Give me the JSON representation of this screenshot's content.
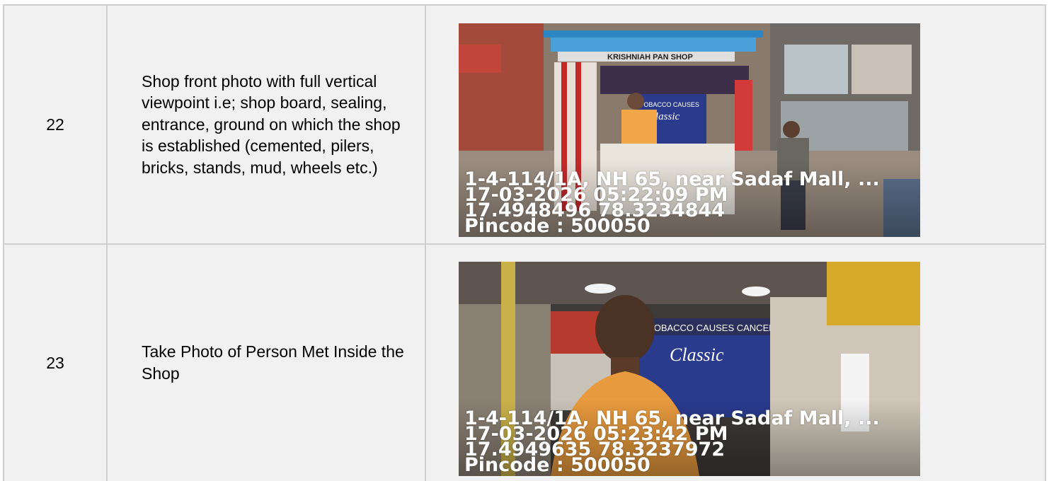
{
  "rows": [
    {
      "number": "22",
      "description": "Shop front photo with full vertical viewpoint i.e; shop board, sealing, entrance, ground on which the shop is established (cemented, pilers, bricks, stands, mud, wheels etc.)",
      "photo": {
        "sign_text": "KRISHNIAH PAN SHOP",
        "poster_text": "TOBACCO CAUSES",
        "brand_text": "Classic",
        "address": "1-4-114/1A, NH 65, near Sadaf Mall, ...",
        "datetime": "17-03-2026 05:22:09 PM",
        "coordinates": "17.4948496 78.3234844",
        "pincode": "Pincode : 500050"
      }
    },
    {
      "number": "23",
      "description": "Take Photo of Person Met Inside the Shop",
      "photo": {
        "poster_text": "TOBACCO CAUSES CANCER",
        "brand_text": "Classic",
        "address": "1-4-114/1A, NH 65, near Sadaf Mall, ...",
        "datetime": "17-03-2026 05:23:42 PM",
        "coordinates": "17.4949635 78.3237972",
        "pincode": "Pincode : 500050"
      }
    }
  ]
}
